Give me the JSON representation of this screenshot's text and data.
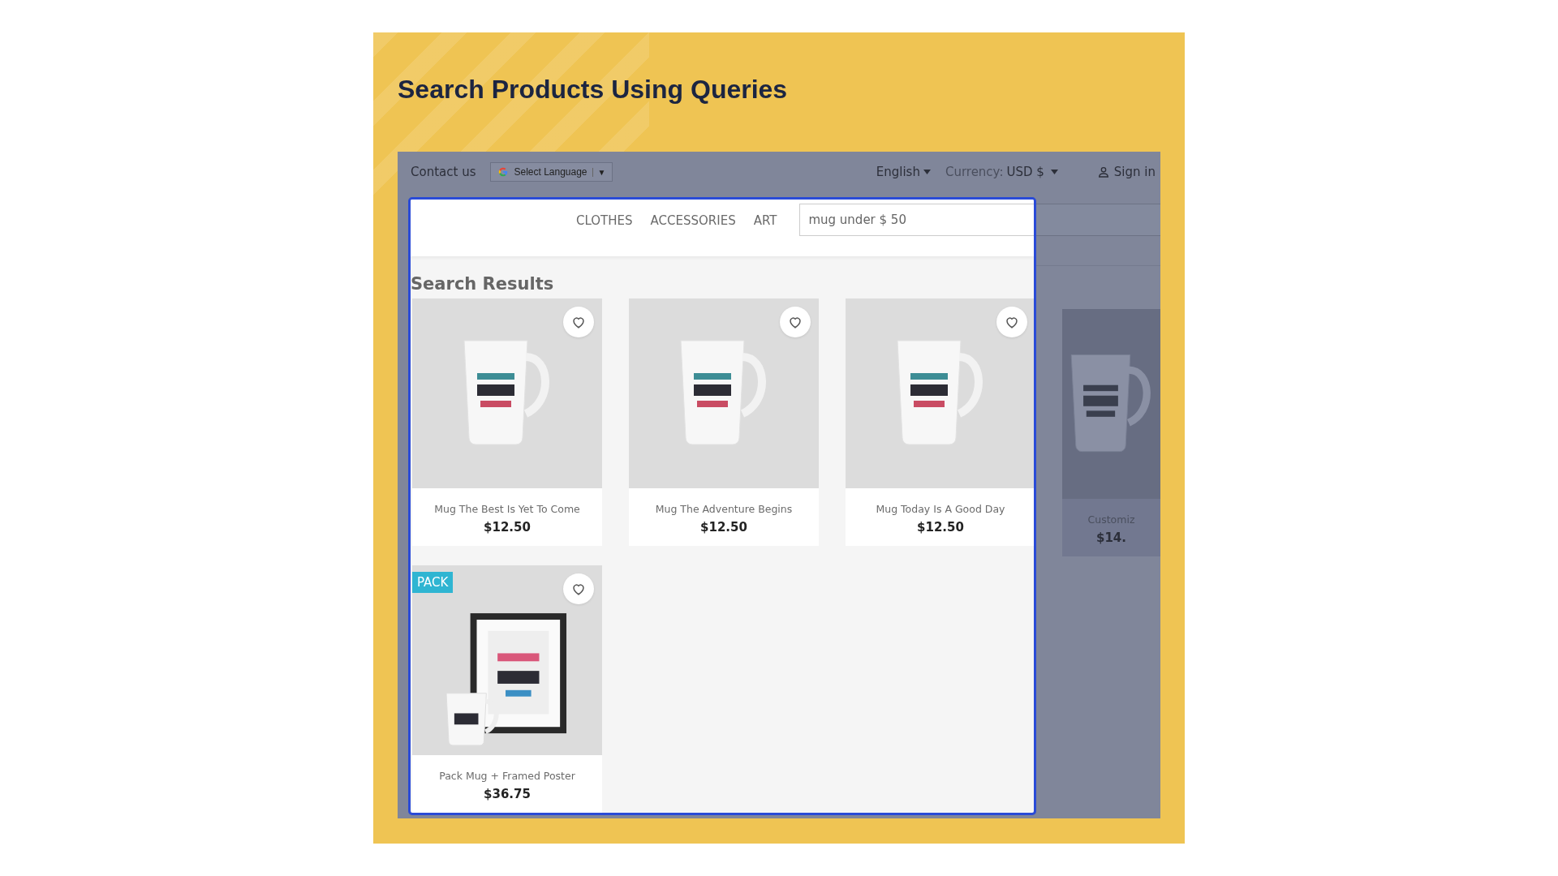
{
  "banner": {
    "title": "Search Products Using Queries"
  },
  "top_bar": {
    "contact": "Contact us",
    "language_select": "Select Language",
    "language_select_caret": "▼",
    "language": "English",
    "currency_label": "Currency:",
    "currency_value": "USD $",
    "sign_in": "Sign in"
  },
  "nav": [
    {
      "label": "CLOTHES"
    },
    {
      "label": "ACCESSORIES"
    },
    {
      "label": "ART"
    }
  ],
  "search": {
    "value": "mug under $ 50"
  },
  "results": {
    "title": "Search Results",
    "products": [
      {
        "name": "Mug The Best Is Yet To Come",
        "price": "$12.50",
        "kind": "mug"
      },
      {
        "name": "Mug The Adventure Begins",
        "price": "$12.50",
        "kind": "mug"
      },
      {
        "name": "Mug Today Is A Good Day",
        "price": "$12.50",
        "kind": "mug"
      },
      {
        "name": "Pack Mug + Framed Poster",
        "price": "$36.75",
        "kind": "pack",
        "badge": "PACK"
      }
    ],
    "dimmed_product": {
      "name": "Customiz",
      "price": "$14."
    }
  }
}
